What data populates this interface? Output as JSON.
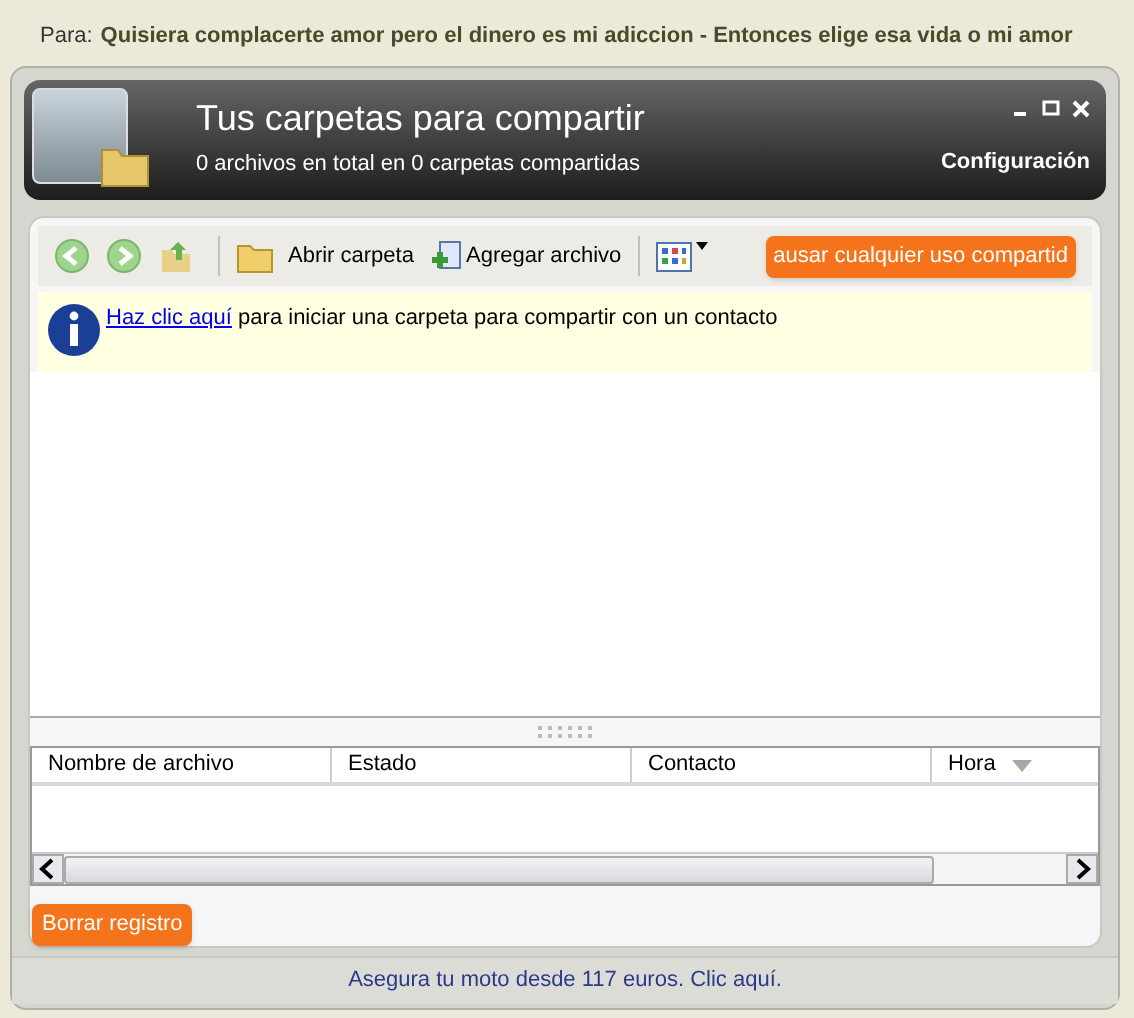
{
  "background_message": {
    "label": "Para:",
    "subject": "Quisiera complacerte amor pero el dinero es mi adiccion - Entonces elige esa vida o mi amor"
  },
  "window": {
    "title": "Tus carpetas para compartir",
    "subtitle": "0 archivos en total en 0 carpetas compartidas",
    "settings_link": "Configuración"
  },
  "toolbar": {
    "open_folder": "Abrir carpeta",
    "add_file": "Agregar archivo",
    "pause_button": "ausar cualquier uso compartid"
  },
  "info_bar": {
    "link": "Haz clic aquí",
    "text": "para iniciar una carpeta para compartir con un contacto"
  },
  "table": {
    "columns": [
      "Nombre de archivo",
      "Estado",
      "Contacto",
      "Hora"
    ]
  },
  "clear_button": "Borrar registro",
  "status_bar": "Asegura tu moto desde 117 euros. Clic aquí."
}
